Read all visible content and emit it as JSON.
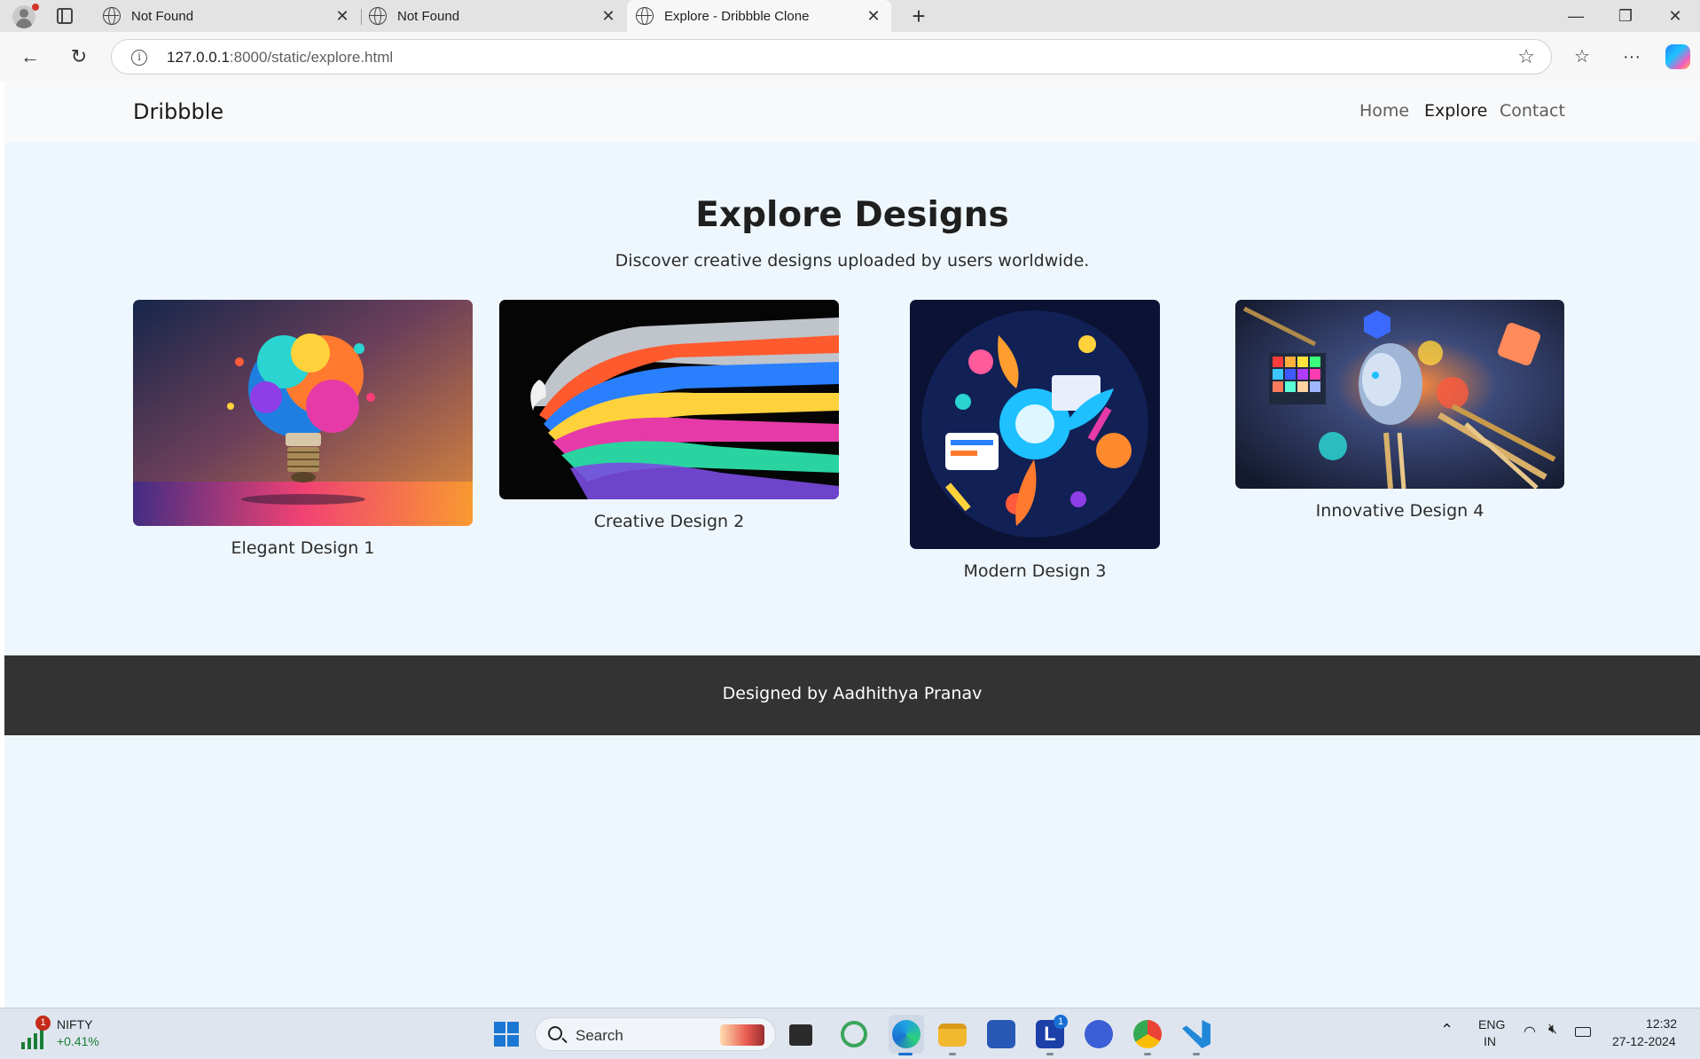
{
  "browser": {
    "tabs": [
      {
        "title": "Not Found",
        "active": false
      },
      {
        "title": "Not Found",
        "active": false
      },
      {
        "title": "Explore - Dribbble Clone",
        "active": true
      }
    ],
    "url_host": "127.0.0.1",
    "url_rest": ":8000/static/explore.html"
  },
  "site": {
    "brand": "Dribbble",
    "nav": [
      {
        "label": "Home",
        "active": false
      },
      {
        "label": "Explore",
        "active": true
      },
      {
        "label": "Contact",
        "active": false
      }
    ],
    "title": "Explore Designs",
    "subtitle": "Discover creative designs uploaded by users worldwide.",
    "designs": [
      {
        "caption": "Elegant Design 1"
      },
      {
        "caption": "Creative Design 2"
      },
      {
        "caption": "Modern Design 3"
      },
      {
        "caption": "Innovative Design 4"
      }
    ],
    "footer": "Designed by Aadhithya Pranav"
  },
  "taskbar": {
    "stock_name": "NIFTY",
    "stock_change": "+0.41%",
    "stock_badge": "1",
    "search_label": "Search",
    "lang_line1": "ENG",
    "lang_line2": "IN",
    "time": "12:32",
    "date": "27-12-2024",
    "l_badge": "1"
  },
  "colors": {
    "page_bg": "#eff7fe",
    "nav_bg": "#f8f9fa",
    "footer_bg": "#333333",
    "positive": "#1a7f37"
  }
}
